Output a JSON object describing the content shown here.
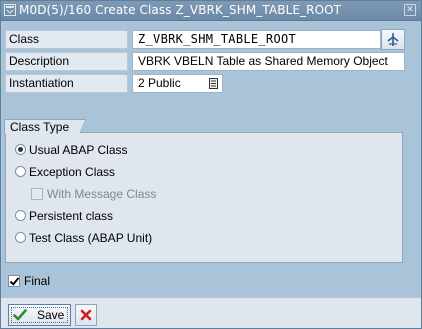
{
  "window": {
    "title": "M0D(5)/160 Create Class Z_VBRK_SHM_TABLE_ROOT"
  },
  "fields": {
    "class": {
      "label": "Class",
      "value": "Z_VBRK_SHM_TABLE_ROOT"
    },
    "description": {
      "label": "Description",
      "value": "VBRK VBELN Table as Shared Memory Object"
    },
    "instantiation": {
      "label": "Instantiation",
      "value": "2 Public"
    }
  },
  "class_type": {
    "heading": "Class Type",
    "options": [
      {
        "label": "Usual ABAP Class",
        "selected": true
      },
      {
        "label": "Exception Class",
        "selected": false
      },
      {
        "label": "With Message Class",
        "checked": false,
        "enabled": false
      },
      {
        "label": "Persistent class",
        "selected": false
      },
      {
        "label": "Test Class (ABAP Unit)",
        "selected": false
      }
    ]
  },
  "final": {
    "label": "Final",
    "checked": true
  },
  "footer": {
    "save_label": "Save",
    "cancel_label": ""
  },
  "colors": {
    "background": "#a9c3d9",
    "titlebar": "#6f8dab",
    "group_background": "#dfe6ee",
    "save_check_green": "#2e8b2e",
    "cancel_red": "#cc1e1e"
  },
  "icons": {
    "window": "window-icon",
    "close": "close-icon",
    "possible_entries": "possible-entries-icon",
    "dropdown": "dropdown-list-icon",
    "save": "green-check-icon",
    "cancel": "red-x-icon"
  }
}
